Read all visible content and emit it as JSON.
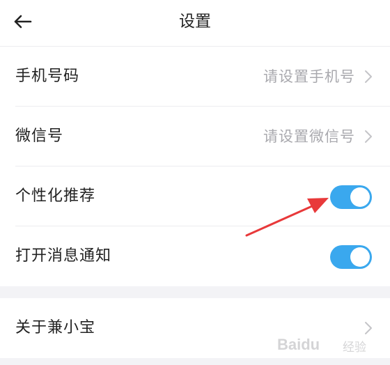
{
  "header": {
    "title": "设置",
    "back_icon": "arrow-left-icon"
  },
  "settings": {
    "phone": {
      "label": "手机号码",
      "value": "请设置手机号"
    },
    "wechat": {
      "label": "微信号",
      "value": "请设置微信号"
    },
    "personalized": {
      "label": "个性化推荐",
      "enabled": true
    },
    "notifications": {
      "label": "打开消息通知",
      "enabled": true
    }
  },
  "about": {
    "label": "关于兼小宝"
  },
  "colors": {
    "toggle_on": "#3aa8ee",
    "annotation_arrow": "#e8393a"
  },
  "watermark": {
    "brand": "Baidu",
    "suffix": "经验"
  }
}
